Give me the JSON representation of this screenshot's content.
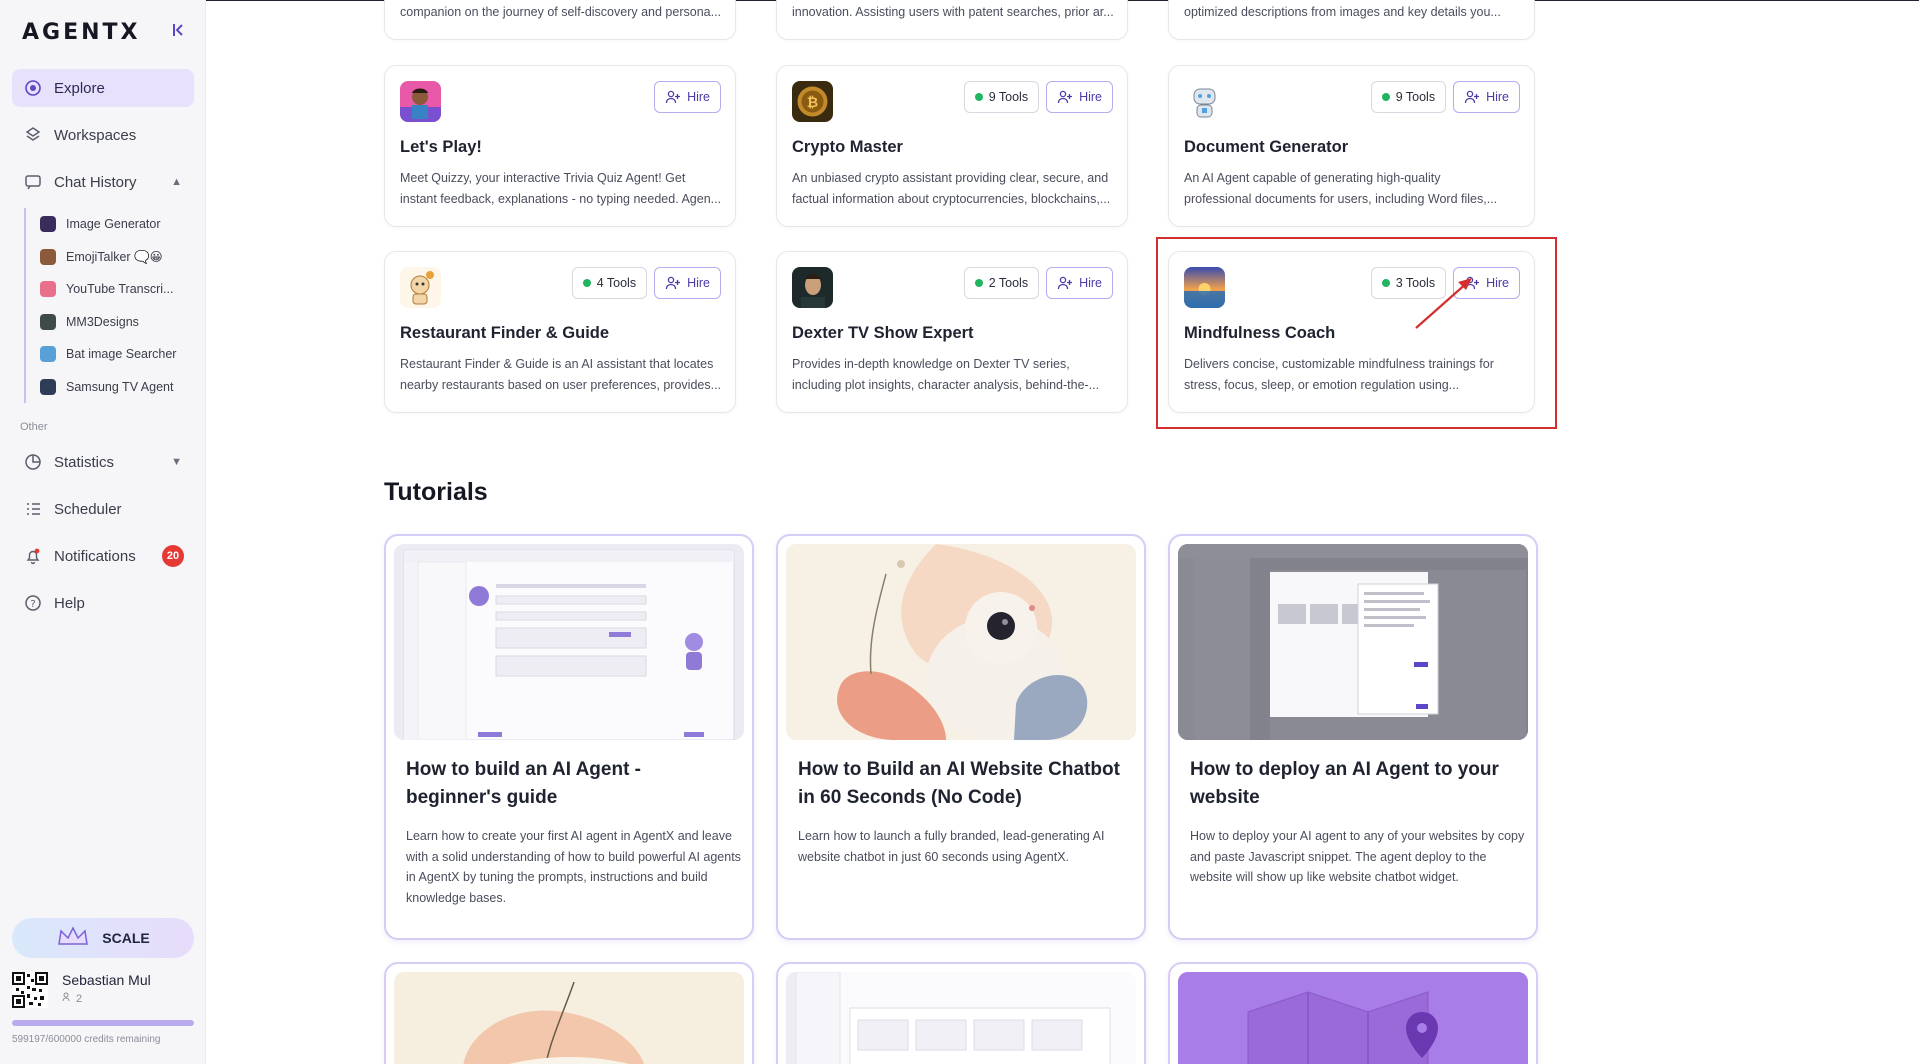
{
  "sidebar": {
    "logo": "AGENTX",
    "collapse_icon": "collapse-icon",
    "nav": {
      "explore": "Explore",
      "workspaces": "Workspaces",
      "chat_history": "Chat History",
      "statistics": "Statistics",
      "scheduler": "Scheduler",
      "notifications": "Notifications",
      "notifications_count": "20",
      "help": "Help"
    },
    "history": [
      {
        "label": "Image Generator",
        "color": "#3a2d5c"
      },
      {
        "label": "EmojiTalker 🗨️😀",
        "color": "#8a5a3a"
      },
      {
        "label": "YouTube Transcri...",
        "color": "#e8708a"
      },
      {
        "label": "MM3Designs",
        "color": "#3f4a4a"
      },
      {
        "label": "Bat image Searcher",
        "color": "#5aa0d8"
      },
      {
        "label": "Samsung TV Agent",
        "color": "#2d3d55"
      }
    ],
    "other_label": "Other",
    "scale_label": "SCALE",
    "user": {
      "name": "Sebastian Mul",
      "members": "2"
    },
    "credits": {
      "text": "599197/600000 credits remaining",
      "fraction": 0.9987
    }
  },
  "top_partial": [
    "companion on the journey of self-discovery and persona...",
    "innovation. Assisting users with patent searches, prior ar...",
    "optimized descriptions from images and key details you..."
  ],
  "agents": [
    {
      "title": "Let's Play!",
      "desc": "Meet Quizzy, your interactive Trivia Quiz Agent! Get instant feedback, explanations - no typing needed. Agen...",
      "tools": "",
      "hire": "Hire"
    },
    {
      "title": "Crypto Master",
      "desc": "An unbiased crypto assistant providing clear, secure, and factual information about cryptocurrencies, blockchains,...",
      "tools": "9 Tools",
      "hire": "Hire"
    },
    {
      "title": "Document Generator",
      "desc": "An AI Agent capable of generating high-quality professional documents for users, including Word files,...",
      "tools": "9 Tools",
      "hire": "Hire"
    },
    {
      "title": "Restaurant Finder & Guide",
      "desc": "Restaurant Finder & Guide is an AI assistant that locates nearby restaurants based on user preferences, provides...",
      "tools": "4 Tools",
      "hire": "Hire"
    },
    {
      "title": "Dexter TV Show Expert",
      "desc": "Provides in-depth knowledge on Dexter TV series, including plot insights, character analysis, behind-the-...",
      "tools": "2 Tools",
      "hire": "Hire"
    },
    {
      "title": "Mindfulness Coach",
      "desc": "Delivers concise, customizable mindfulness trainings for stress, focus, sleep, or emotion regulation using...",
      "tools": "3 Tools",
      "hire": "Hire"
    }
  ],
  "tutorials_title": "Tutorials",
  "tutorials": [
    {
      "title": "How to build an AI Agent - beginner's guide",
      "desc": "Learn how to create your first AI agent in AgentX and leave with a solid understanding of how to build powerful AI agents in AgentX by tuning the prompts, instructions and build knowledge bases."
    },
    {
      "title": "How to Build an AI Website Chatbot in 60 Seconds (No Code)",
      "desc": "Learn how to launch a fully branded, lead-generating AI website chatbot in just 60 seconds using AgentX."
    },
    {
      "title": "How to deploy an AI Agent to your website",
      "desc": "How to deploy your AI agent to any of your websites by copy and paste Javascript snippet. The agent deploy to the website will show up like website chatbot widget."
    }
  ],
  "colors": {
    "accent": "#5f46c9",
    "highlight": "#d32f2f",
    "tool_dot": "#22b561",
    "badge": "#e53935"
  }
}
